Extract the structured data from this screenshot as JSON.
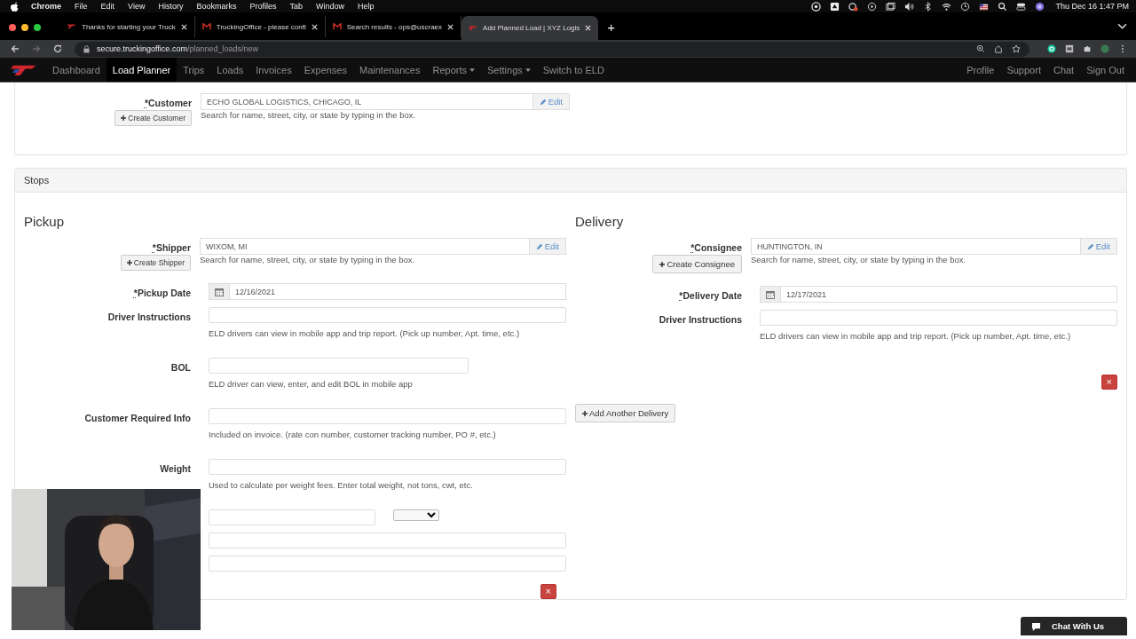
{
  "menubar": {
    "items": [
      {
        "label": "Chrome",
        "bold": true
      },
      {
        "label": "File",
        "bold": false
      },
      {
        "label": "Edit",
        "bold": false
      },
      {
        "label": "View",
        "bold": false
      },
      {
        "label": "History",
        "bold": false
      },
      {
        "label": "Bookmarks",
        "bold": false
      },
      {
        "label": "Profiles",
        "bold": false
      },
      {
        "label": "Tab",
        "bold": false
      },
      {
        "label": "Window",
        "bold": false
      },
      {
        "label": "Help",
        "bold": false
      }
    ],
    "clock": "Thu Dec 16  1:47 PM"
  },
  "tabs": [
    {
      "title": "Thanks for starting your Truck",
      "kind": "site",
      "selected": false
    },
    {
      "title": "TruckingOffice - please confi",
      "kind": "mail",
      "selected": false
    },
    {
      "title": "Search results - ops@uscraex",
      "kind": "mail",
      "selected": false
    },
    {
      "title": "Add Planned Load | XYZ Logis",
      "kind": "site",
      "selected": true
    }
  ],
  "new_tab": "+",
  "address": {
    "host": "secure.truckingoffice.com",
    "path": "/planned_loads/new"
  },
  "nav": {
    "items": [
      {
        "label": "Dashboard",
        "selected": false,
        "dropdown": false
      },
      {
        "label": "Load Planner",
        "selected": true,
        "dropdown": false
      },
      {
        "label": "Trips",
        "selected": false,
        "dropdown": false
      },
      {
        "label": "Loads",
        "selected": false,
        "dropdown": false
      },
      {
        "label": "Invoices",
        "selected": false,
        "dropdown": false
      },
      {
        "label": "Expenses",
        "selected": false,
        "dropdown": false
      },
      {
        "label": "Maintenances",
        "selected": false,
        "dropdown": false
      },
      {
        "label": "Reports",
        "selected": false,
        "dropdown": true
      },
      {
        "label": "Settings",
        "selected": false,
        "dropdown": true
      },
      {
        "label": "Switch to ELD",
        "selected": false,
        "dropdown": false
      }
    ],
    "right": [
      "Profile",
      "Support",
      "Chat",
      "Sign Out"
    ]
  },
  "customer": {
    "kind": "lookup",
    "required_mark": "*",
    "label": "Customer",
    "value": "ECHO GLOBAL LOGISTICS, CHICAGO, IL",
    "edit_label": "Edit",
    "create_label": "Create Customer",
    "help": "Search for name, street, city, or state by typing in the box."
  },
  "stops": {
    "title": "Stops",
    "pickup": {
      "title": "Pickup",
      "fields": [
        {
          "kind": "lookup",
          "required_mark": "*",
          "label": "Shipper",
          "value": "WIXOM, MI",
          "edit_label": "Edit",
          "create_label": "Create Shipper",
          "help": "Search for name, street, city, or state by typing in the box."
        },
        {
          "kind": "date",
          "required_mark": "*",
          "label": "Pickup Date",
          "value": "12/16/2021"
        },
        {
          "kind": "text",
          "label": "Driver Instructions",
          "help": "ELD drivers can view in mobile app and trip report. (Pick up number, Apt. time, etc.)"
        },
        {
          "kind": "short_text",
          "label": "BOL",
          "help": "ELD driver can view, enter, and edit BOL in mobile app"
        },
        {
          "kind": "text",
          "label": "Customer Required Info",
          "help": "Included on invoice. (rate con number, customer tracking number, PO #, etc.)"
        },
        {
          "kind": "text",
          "label": "Weight",
          "help": "Used to calculate per weight fees. Enter total weight, not tons, cwt, etc."
        },
        {
          "kind": "unit_row"
        },
        {
          "kind": "text"
        },
        {
          "kind": "text"
        }
      ],
      "remove": "×"
    },
    "delivery": {
      "title": "Delivery",
      "fields": [
        {
          "kind": "lookup",
          "required_mark": "*",
          "label": "Consignee",
          "value": "HUNTINGTON, IN",
          "edit_label": "Edit",
          "create_label": "Create Consignee",
          "help": "Search for name, street, city, or state by typing in the box."
        },
        {
          "kind": "date",
          "required_mark": "*",
          "label": "Delivery Date",
          "value": "12/17/2021"
        },
        {
          "kind": "text",
          "label": "Driver Instructions",
          "help": "ELD drivers can view in mobile app and trip report. (Pick up number, Apt. time, etc.)"
        }
      ],
      "remove": "×",
      "add_label": "Add Another Delivery"
    }
  },
  "chat_button": "Chat With Us"
}
